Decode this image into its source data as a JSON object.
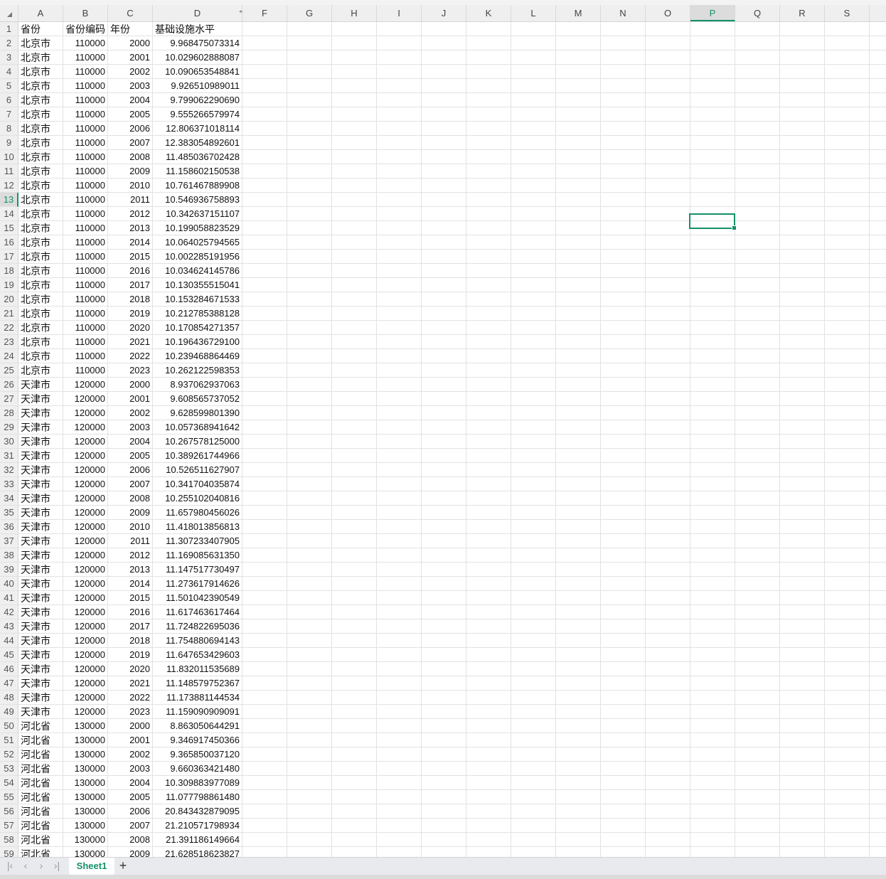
{
  "columns": [
    "A",
    "B",
    "C",
    "D",
    "F",
    "G",
    "H",
    "I",
    "J",
    "K",
    "L",
    "M",
    "N",
    "O",
    "P",
    "Q",
    "R",
    "S"
  ],
  "selected": {
    "column": "P",
    "row": 13
  },
  "header_row": [
    "省份",
    "省份编码",
    "年份",
    "基础设施水平"
  ],
  "rows": [
    [
      "北京市",
      "110000",
      "2000",
      "9.968475073314"
    ],
    [
      "北京市",
      "110000",
      "2001",
      "10.029602888087"
    ],
    [
      "北京市",
      "110000",
      "2002",
      "10.090653548841"
    ],
    [
      "北京市",
      "110000",
      "2003",
      "9.926510989011"
    ],
    [
      "北京市",
      "110000",
      "2004",
      "9.799062290690"
    ],
    [
      "北京市",
      "110000",
      "2005",
      "9.555266579974"
    ],
    [
      "北京市",
      "110000",
      "2006",
      "12.806371018114"
    ],
    [
      "北京市",
      "110000",
      "2007",
      "12.383054892601"
    ],
    [
      "北京市",
      "110000",
      "2008",
      "11.485036702428"
    ],
    [
      "北京市",
      "110000",
      "2009",
      "11.158602150538"
    ],
    [
      "北京市",
      "110000",
      "2010",
      "10.761467889908"
    ],
    [
      "北京市",
      "110000",
      "2011",
      "10.546936758893"
    ],
    [
      "北京市",
      "110000",
      "2012",
      "10.342637151107"
    ],
    [
      "北京市",
      "110000",
      "2013",
      "10.199058823529"
    ],
    [
      "北京市",
      "110000",
      "2014",
      "10.064025794565"
    ],
    [
      "北京市",
      "110000",
      "2015",
      "10.002285191956"
    ],
    [
      "北京市",
      "110000",
      "2016",
      "10.034624145786"
    ],
    [
      "北京市",
      "110000",
      "2017",
      "10.130355515041"
    ],
    [
      "北京市",
      "110000",
      "2018",
      "10.153284671533"
    ],
    [
      "北京市",
      "110000",
      "2019",
      "10.212785388128"
    ],
    [
      "北京市",
      "110000",
      "2020",
      "10.170854271357"
    ],
    [
      "北京市",
      "110000",
      "2021",
      "10.196436729100"
    ],
    [
      "北京市",
      "110000",
      "2022",
      "10.239468864469"
    ],
    [
      "北京市",
      "110000",
      "2023",
      "10.262122598353"
    ],
    [
      "天津市",
      "120000",
      "2000",
      "8.937062937063"
    ],
    [
      "天津市",
      "120000",
      "2001",
      "9.608565737052"
    ],
    [
      "天津市",
      "120000",
      "2002",
      "9.628599801390"
    ],
    [
      "天津市",
      "120000",
      "2003",
      "10.057368941642"
    ],
    [
      "天津市",
      "120000",
      "2004",
      "10.267578125000"
    ],
    [
      "天津市",
      "120000",
      "2005",
      "10.389261744966"
    ],
    [
      "天津市",
      "120000",
      "2006",
      "10.526511627907"
    ],
    [
      "天津市",
      "120000",
      "2007",
      "10.341704035874"
    ],
    [
      "天津市",
      "120000",
      "2008",
      "10.255102040816"
    ],
    [
      "天津市",
      "120000",
      "2009",
      "11.657980456026"
    ],
    [
      "天津市",
      "120000",
      "2010",
      "11.418013856813"
    ],
    [
      "天津市",
      "120000",
      "2011",
      "11.307233407905"
    ],
    [
      "天津市",
      "120000",
      "2012",
      "11.169085631350"
    ],
    [
      "天津市",
      "120000",
      "2013",
      "11.147517730497"
    ],
    [
      "天津市",
      "120000",
      "2014",
      "11.273617914626"
    ],
    [
      "天津市",
      "120000",
      "2015",
      "11.501042390549"
    ],
    [
      "天津市",
      "120000",
      "2016",
      "11.617463617464"
    ],
    [
      "天津市",
      "120000",
      "2017",
      "11.724822695036"
    ],
    [
      "天津市",
      "120000",
      "2018",
      "11.754880694143"
    ],
    [
      "天津市",
      "120000",
      "2019",
      "11.647653429603"
    ],
    [
      "天津市",
      "120000",
      "2020",
      "11.832011535689"
    ],
    [
      "天津市",
      "120000",
      "2021",
      "11.148579752367"
    ],
    [
      "天津市",
      "120000",
      "2022",
      "11.173881144534"
    ],
    [
      "天津市",
      "120000",
      "2023",
      "11.159090909091"
    ],
    [
      "河北省",
      "130000",
      "2000",
      "8.863050644291"
    ],
    [
      "河北省",
      "130000",
      "2001",
      "9.346917450366"
    ],
    [
      "河北省",
      "130000",
      "2002",
      "9.365850037120"
    ],
    [
      "河北省",
      "130000",
      "2003",
      "9.660363421480"
    ],
    [
      "河北省",
      "130000",
      "2004",
      "10.309883977089"
    ],
    [
      "河北省",
      "130000",
      "2005",
      "11.077798861480"
    ],
    [
      "河北省",
      "130000",
      "2006",
      "20.843432879095"
    ],
    [
      "河北省",
      "130000",
      "2007",
      "21.210571798934"
    ],
    [
      "河北省",
      "130000",
      "2008",
      "21.391186149664"
    ],
    [
      "河北省",
      "130000",
      "2009",
      "21.628518623827"
    ]
  ],
  "sheet_tabs": {
    "active": "Sheet1",
    "add_label": "+"
  },
  "nav": {
    "first": "|‹",
    "prev": "‹",
    "next": "›",
    "last": "›|"
  },
  "accent_color": "#14906a"
}
